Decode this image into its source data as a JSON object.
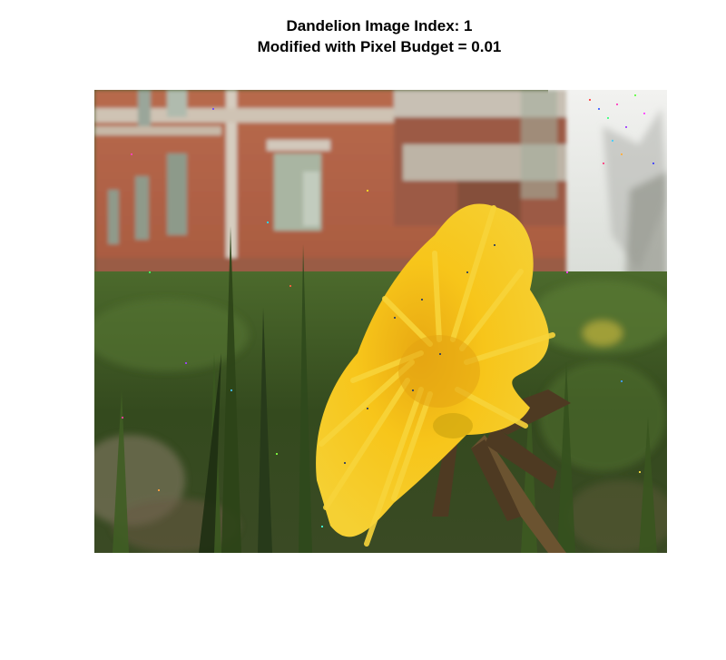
{
  "figure": {
    "title_line1": "Dandelion Image Index:  1",
    "title_line2": "Modified with Pixel Budget =  0.01"
  },
  "image": {
    "subject": "yellow dandelion flower in grass in front of a brick building",
    "colors": {
      "brick": "#b8664a",
      "window": "#a8b4a0",
      "sky": "#ecedeb",
      "grass_dark": "#2c3c1c",
      "grass_mid": "#4a6a2a",
      "petal": "#f4c417",
      "petal_dark": "#d99a0a",
      "stem": "#6b5330"
    }
  }
}
